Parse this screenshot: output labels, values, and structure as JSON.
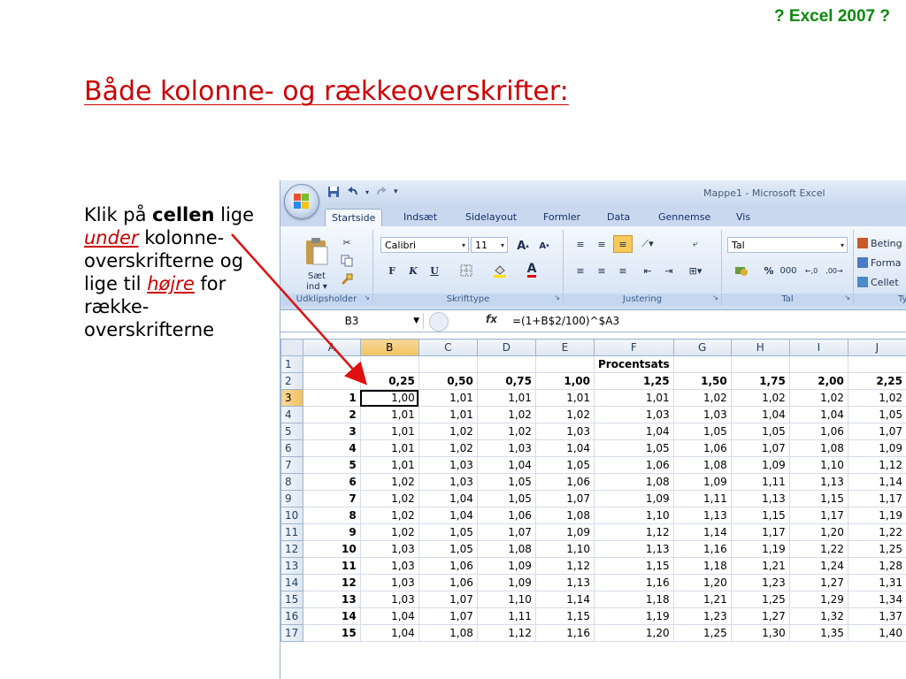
{
  "corner_tag": "? Excel 2007 ?",
  "slide_title": "Både kolonne- og rækkeoverskrifter:",
  "body": {
    "part1": "Klik på ",
    "bold1": "cellen",
    "part2": " lige ",
    "em1": "under",
    "part3": " kolonne-overskrifterne og lige til ",
    "em2": "højre",
    "part4": " for række-overskrifterne"
  },
  "excel": {
    "window_title": "Mappe1 - Microsoft Excel",
    "tabs": [
      "Startside",
      "Indsæt",
      "Sidelayout",
      "Formler",
      "Data",
      "Gennemse",
      "Vis"
    ],
    "active_tab": "Startside",
    "ribbon": {
      "clipboard_label": "Udklipsholder",
      "paste_label_1": "Sæt",
      "paste_label_2": "ind",
      "font_label": "Skrifttype",
      "font_name": "Calibri",
      "font_size": "11",
      "bold": "F",
      "italic": "K",
      "underline": "U",
      "alignment_label": "Justering",
      "number_label": "Tal",
      "number_format": "Tal",
      "percent": "%",
      "thousands": "000",
      "styles_label": "Ty",
      "styles": [
        "Beting",
        "Forma",
        "Cellet"
      ]
    },
    "name_box": "B3",
    "fx": "fx",
    "formula": "=(1+B$2/100)^$A3",
    "column_headers": [
      "A",
      "B",
      "C",
      "D",
      "E",
      "F",
      "G",
      "H",
      "I",
      "J"
    ],
    "rows": [
      {
        "n": "1",
        "cells": [
          "",
          "",
          "",
          "",
          "",
          "Procentsats",
          "",
          "",
          "",
          ""
        ]
      },
      {
        "n": "2",
        "cells": [
          "",
          "0,25",
          "0,50",
          "0,75",
          "1,00",
          "1,25",
          "1,50",
          "1,75",
          "2,00",
          "2,25"
        ]
      },
      {
        "n": "3",
        "cells": [
          "1",
          "1,00",
          "1,01",
          "1,01",
          "1,01",
          "1,01",
          "1,02",
          "1,02",
          "1,02",
          "1,02"
        ]
      },
      {
        "n": "4",
        "cells": [
          "2",
          "1,01",
          "1,01",
          "1,02",
          "1,02",
          "1,03",
          "1,03",
          "1,04",
          "1,04",
          "1,05"
        ]
      },
      {
        "n": "5",
        "cells": [
          "3",
          "1,01",
          "1,02",
          "1,02",
          "1,03",
          "1,04",
          "1,05",
          "1,05",
          "1,06",
          "1,07"
        ]
      },
      {
        "n": "6",
        "cells": [
          "4",
          "1,01",
          "1,02",
          "1,03",
          "1,04",
          "1,05",
          "1,06",
          "1,07",
          "1,08",
          "1,09"
        ]
      },
      {
        "n": "7",
        "cells": [
          "5",
          "1,01",
          "1,03",
          "1,04",
          "1,05",
          "1,06",
          "1,08",
          "1,09",
          "1,10",
          "1,12"
        ]
      },
      {
        "n": "8",
        "cells": [
          "6",
          "1,02",
          "1,03",
          "1,05",
          "1,06",
          "1,08",
          "1,09",
          "1,11",
          "1,13",
          "1,14"
        ]
      },
      {
        "n": "9",
        "cells": [
          "7",
          "1,02",
          "1,04",
          "1,05",
          "1,07",
          "1,09",
          "1,11",
          "1,13",
          "1,15",
          "1,17"
        ]
      },
      {
        "n": "10",
        "cells": [
          "8",
          "1,02",
          "1,04",
          "1,06",
          "1,08",
          "1,10",
          "1,13",
          "1,15",
          "1,17",
          "1,19"
        ]
      },
      {
        "n": "11",
        "cells": [
          "9",
          "1,02",
          "1,05",
          "1,07",
          "1,09",
          "1,12",
          "1,14",
          "1,17",
          "1,20",
          "1,22"
        ]
      },
      {
        "n": "12",
        "cells": [
          "10",
          "1,03",
          "1,05",
          "1,08",
          "1,10",
          "1,13",
          "1,16",
          "1,19",
          "1,22",
          "1,25"
        ]
      },
      {
        "n": "13",
        "cells": [
          "11",
          "1,03",
          "1,06",
          "1,09",
          "1,12",
          "1,15",
          "1,18",
          "1,21",
          "1,24",
          "1,28"
        ]
      },
      {
        "n": "14",
        "cells": [
          "12",
          "1,03",
          "1,06",
          "1,09",
          "1,13",
          "1,16",
          "1,20",
          "1,23",
          "1,27",
          "1,31"
        ]
      },
      {
        "n": "15",
        "cells": [
          "13",
          "1,03",
          "1,07",
          "1,10",
          "1,14",
          "1,18",
          "1,21",
          "1,25",
          "1,29",
          "1,34"
        ]
      },
      {
        "n": "16",
        "cells": [
          "14",
          "1,04",
          "1,07",
          "1,11",
          "1,15",
          "1,19",
          "1,23",
          "1,27",
          "1,32",
          "1,37"
        ]
      },
      {
        "n": "17",
        "cells": [
          "15",
          "1,04",
          "1,08",
          "1,12",
          "1,16",
          "1,20",
          "1,25",
          "1,30",
          "1,35",
          "1,40"
        ]
      }
    ],
    "selected_cell": "B3"
  }
}
